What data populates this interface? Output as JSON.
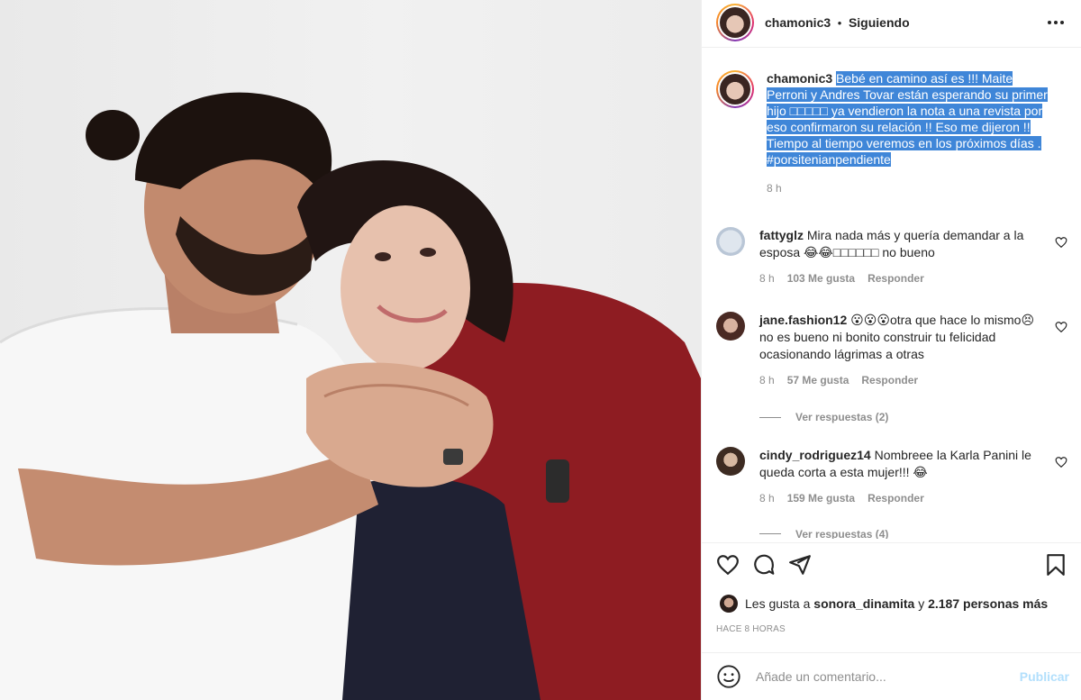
{
  "header": {
    "username": "chamonic3",
    "separator": "•",
    "follow_status": "Siguiendo"
  },
  "caption": {
    "username": "chamonic3",
    "text": "Bebé en camino así es !!! Maite Perroni y Andres Tovar están esperando su primer hijo □□□□□ ya vendieron la nota a una revista por eso confirmaron su relación !! Eso me dijeron !! Tiempo al tiempo veremos en los próximos días .",
    "hashtag": "#porsitenianpendiente",
    "time": "8 h"
  },
  "comments": [
    {
      "username": "fattyglz",
      "text": "Mira nada más y quería demandar a la esposa 😂😂□□□□□□ no bueno",
      "time": "8 h",
      "likes": "103 Me gusta",
      "reply": "Responder"
    },
    {
      "username": "jane.fashion12",
      "text": "😮😮😮otra que hace lo mismo😣 no es bueno ni bonito construir tu felicidad ocasionando lágrimas a otras",
      "time": "8 h",
      "likes": "57 Me gusta",
      "reply": "Responder",
      "view_replies": "Ver respuestas (2)"
    },
    {
      "username": "cindy_rodriguez14",
      "text": "Nombreee la Karla Panini le queda corta a esta mujer!!! 😂",
      "time": "8 h",
      "likes": "159 Me gusta",
      "reply": "Responder",
      "view_replies": "Ver respuestas (4)"
    }
  ],
  "likes_line": {
    "prefix": "Les gusta a",
    "user": "sonora_dinamita",
    "connector": "y",
    "others": "2.187 personas más"
  },
  "posted_ago": "HACE 8 HORAS",
  "add_comment": {
    "placeholder": "Añade un comentario...",
    "publish": "Publicar"
  },
  "icons": [
    "more-options-icon",
    "heart-icon",
    "comment-icon",
    "share-icon",
    "bookmark-icon",
    "emoji-icon"
  ],
  "colors": {
    "selection": "#3f86d8",
    "link": "#00376b",
    "muted": "#8e8e8e",
    "publish_disabled": "#b2dffc",
    "dress": "#8e1c22"
  }
}
